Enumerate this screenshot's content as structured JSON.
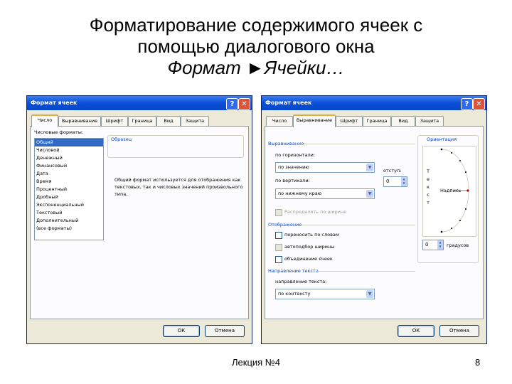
{
  "slide": {
    "title_line1": "Форматирование содержимого ячеек с",
    "title_line2": "помощью диалогового окна",
    "title_line3": "Формат ►Ячейки…",
    "footer": "Лекция №4",
    "page_number": "8"
  },
  "dialog1": {
    "title": "Формат ячеек",
    "help_glyph": "?",
    "close_glyph": "✕",
    "tabs": [
      "Число",
      "Выравнивание",
      "Шрифт",
      "Граница",
      "Вид",
      "Защита"
    ],
    "formats_label": "Числовые форматы:",
    "formats": [
      "Общий",
      "Числовой",
      "Денежный",
      "Финансовый",
      "Дата",
      "Время",
      "Процентный",
      "Дробный",
      "Экспоненциальный",
      "Текстовый",
      "Дополнительный",
      "(все форматы)"
    ],
    "sample_label": "Образец",
    "description": "Общий формат используется для отображения как текстовых, так и числовых значений произвольного типа.",
    "ok_label": "ОК",
    "cancel_label": "Отмена"
  },
  "dialog2": {
    "title": "Формат ячеек",
    "help_glyph": "?",
    "close_glyph": "✕",
    "tabs": [
      "Число",
      "Выравнивание",
      "Шрифт",
      "Граница",
      "Вид",
      "Защита"
    ],
    "alignment_section": "Выравнивание",
    "horizontal_label": "по горизонтали:",
    "horizontal_value": "по значению",
    "indent_label": "отступ:",
    "indent_value": "0",
    "vertical_label": "по вертикали:",
    "vertical_value": "по нижнему краю",
    "distributed_label": "Распределять по ширине",
    "display_section": "Отображение",
    "wrap_label": "переносить по словам",
    "shrink_label": "автоподбор ширины",
    "merge_label": "объединение ячеек",
    "direction_section": "Направление текста",
    "direction_label": "направление текста:",
    "direction_value": "по контексту",
    "orientation_label": "Ориентация",
    "vertical_text": "Т е к с т",
    "orientation_sample": "Надпись",
    "degrees_value": "0",
    "degrees_label": "градусов",
    "ok_label": "ОК",
    "cancel_label": "Отмена"
  }
}
